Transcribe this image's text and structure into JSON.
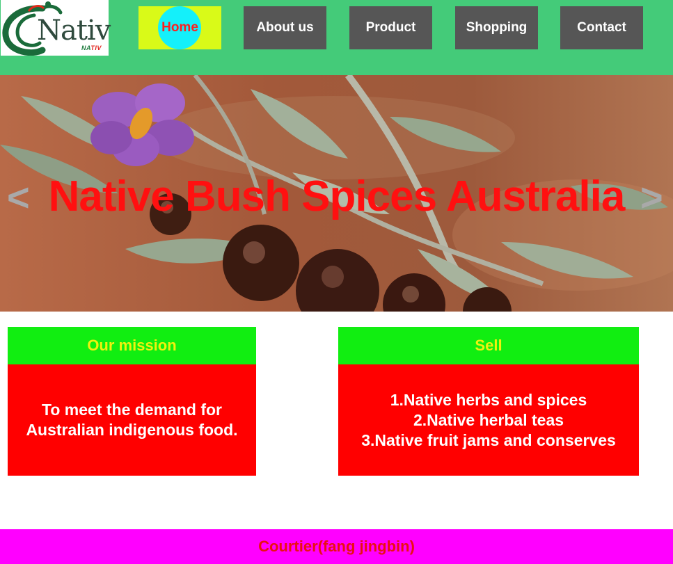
{
  "logo": {
    "word": "Nativ",
    "sub_green": "NA",
    "sub_red": "TIV"
  },
  "nav": {
    "home": "Home",
    "about": "About us",
    "product": "Product",
    "shopping": "Shopping",
    "contact": "Contact"
  },
  "hero": {
    "title": "Native Bush Spices Australia",
    "prev_arrow": "<",
    "next_arrow": ">"
  },
  "mission": {
    "heading": "Our mission",
    "lines": [
      "To meet the demand for",
      "Australian indigenous food."
    ]
  },
  "sell": {
    "heading": "Sell",
    "items": [
      "1.Native herbs and spices",
      "2.Native herbal teas",
      "3.Native fruit jams and conserves"
    ]
  },
  "footer": {
    "text": "Courtier(fang jingbin)"
  },
  "colors": {
    "header_bg": "#44cb79",
    "nav_bg": "#565656",
    "home_bg": "#d9fa18",
    "home_circle": "#14f0fa",
    "card_head": "#11ee11",
    "card_body": "#ff0000",
    "footer_bg": "#ff00ff"
  }
}
